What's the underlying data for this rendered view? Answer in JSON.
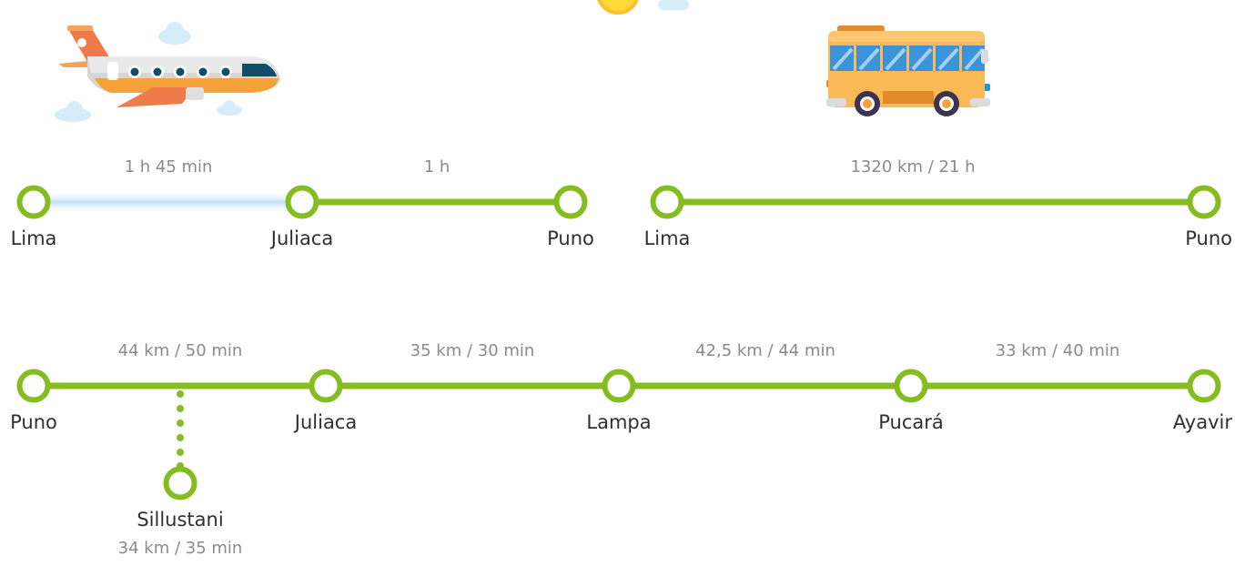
{
  "colors": {
    "line": "#85bc20",
    "flight": "#bfe2f7",
    "text": "#2f2f2f",
    "subtext": "#8a8a8a"
  },
  "icons": {
    "plane": "airplane-icon",
    "bus": "bus-icon",
    "sun": "sun-icon",
    "cloud": "cloud-icon"
  },
  "routes": {
    "air": {
      "stops": [
        "Lima",
        "Juliaca",
        "Puno"
      ],
      "segments": [
        "1 h 45 min",
        "1 h"
      ],
      "segment_modes": [
        "flight",
        "road"
      ]
    },
    "bus": {
      "stops": [
        "Lima",
        "Puno"
      ],
      "segments": [
        "1320 km / 21 h"
      ]
    },
    "road": {
      "stops": [
        "Puno",
        "Juliaca",
        "Lampa",
        "Pucará",
        "Ayavir"
      ],
      "segments": [
        "44 km / 50 min",
        "35 km / 30 min",
        "42,5 km / 44 min",
        "33 km / 40 min"
      ],
      "branch": {
        "stop": "Sillustani",
        "distance": "34 km / 35 min"
      }
    }
  }
}
